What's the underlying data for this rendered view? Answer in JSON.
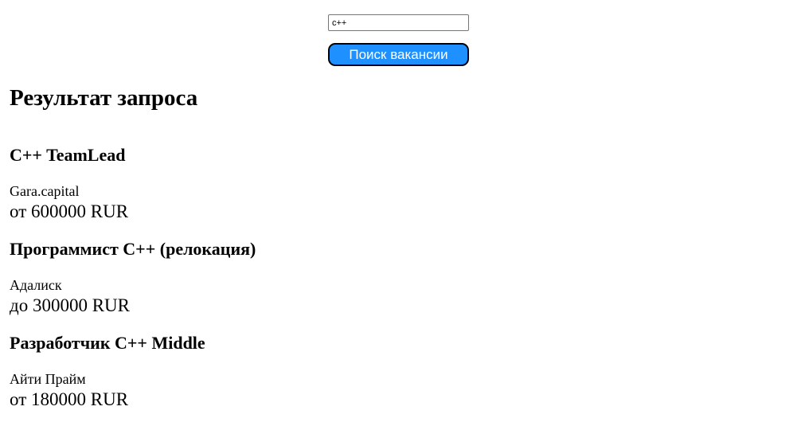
{
  "search": {
    "value": "c++",
    "button_label": "Поиск вакансии"
  },
  "results": {
    "title": "Результат запроса",
    "vacancies": [
      {
        "title": "C++ TeamLead",
        "company": "Gara.capital",
        "salary": "от 600000 RUR"
      },
      {
        "title": "Программист C++ (релокация)",
        "company": "Адалиск",
        "salary": "до 300000 RUR"
      },
      {
        "title": "Разработчик C++ Middle",
        "company": "Айти Прайм",
        "salary": "от 180000 RUR"
      }
    ]
  },
  "colors": {
    "button_background": "#1e90ff",
    "button_text": "#ffffff",
    "button_border": "#000000"
  }
}
